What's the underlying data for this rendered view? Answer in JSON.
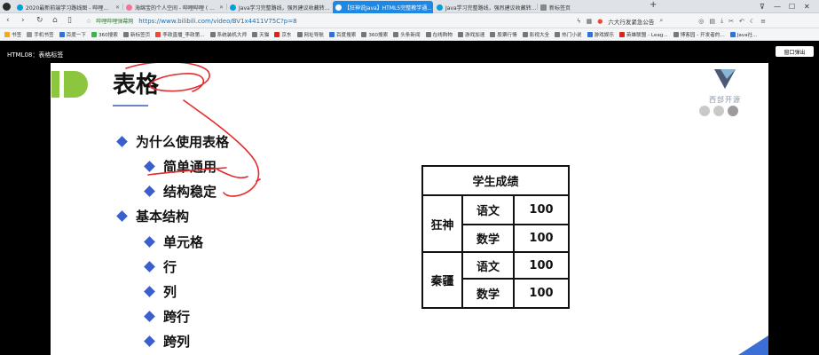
{
  "browser": {
    "tabs": [
      {
        "label": "2020最新前端学习路线图 - 哔哩...",
        "color": "#00a1d6",
        "active": false
      },
      {
        "label": "海绵宝的个人空间 - 哔哩哔哩 ( ...",
        "color": "#fb7299",
        "active": false
      },
      {
        "label": "Java学习完整路线，强烈建议收藏转...",
        "color": "#00a1d6",
        "active": false
      },
      {
        "label": "【狂神说Java】HTML5完整教学通...",
        "color": "#00a1d6",
        "active": true
      },
      {
        "label": "Java学习完整路线，强烈建议收藏转...",
        "color": "#00a1d6",
        "active": false
      },
      {
        "label": "新标签页",
        "color": "#888888",
        "active": false
      }
    ],
    "new_tab": "+",
    "window_controls": [
      "⊽",
      "—",
      "☐",
      "✕"
    ],
    "url_badge": "哔哩哔哩弹幕网",
    "url": "https://www.bilibili.com/video/BV1x4411V75C?p=8",
    "search_hint": "六大行发紧急公告",
    "bookmarks": [
      {
        "label": "书签",
        "color": "#f5a623"
      },
      {
        "label": "手机书签",
        "color": "#999999"
      },
      {
        "label": "百度一下",
        "color": "#2f6fde"
      },
      {
        "label": "360搜索",
        "color": "#3bb54a"
      },
      {
        "label": "新标签页",
        "color": "#777777"
      },
      {
        "label": "李政直播_李政第...",
        "color": "#e84b3c"
      },
      {
        "label": "系统装机大师",
        "color": "#777777"
      },
      {
        "label": "天猫",
        "color": "#777777"
      },
      {
        "label": "京东",
        "color": "#d7261b"
      },
      {
        "label": "网址导航",
        "color": "#777777"
      },
      {
        "label": "百度搜索",
        "color": "#2f6fde"
      },
      {
        "label": "360搜索",
        "color": "#777777"
      },
      {
        "label": "头条新闻",
        "color": "#777777"
      },
      {
        "label": "在线购物",
        "color": "#777777"
      },
      {
        "label": "游戏加速",
        "color": "#777777"
      },
      {
        "label": "股票行情",
        "color": "#777777"
      },
      {
        "label": "影视大全",
        "color": "#777777"
      },
      {
        "label": "热门小说",
        "color": "#777777"
      },
      {
        "label": "游戏娱乐",
        "color": "#2f6fde"
      },
      {
        "label": "英雄联盟 - Leag...",
        "color": "#d7261b"
      },
      {
        "label": "博客园 - 开发者的...",
        "color": "#777777"
      },
      {
        "label": "Java社...",
        "color": "#2f6fde"
      }
    ]
  },
  "video": {
    "title": "HTML08：表格标签",
    "popout_label": "窗口弹出"
  },
  "slide": {
    "title": "表格",
    "brand_name": "西部开源",
    "bullets": [
      {
        "text": "为什么使用表格",
        "level": 1
      },
      {
        "text": "简单通用",
        "level": 2
      },
      {
        "text": "结构稳定",
        "level": 2
      },
      {
        "text": "基本结构",
        "level": 1
      },
      {
        "text": "单元格",
        "level": 2
      },
      {
        "text": "行",
        "level": 2
      },
      {
        "text": "列",
        "level": 2
      },
      {
        "text": "跨行",
        "level": 2
      },
      {
        "text": "跨列",
        "level": 2
      }
    ],
    "table": {
      "caption": "学生成绩",
      "groups": [
        {
          "name": "狂神",
          "rows": [
            {
              "subject": "语文",
              "score": "100"
            },
            {
              "subject": "数学",
              "score": "100"
            }
          ]
        },
        {
          "name": "秦疆",
          "rows": [
            {
              "subject": "语文",
              "score": "100"
            },
            {
              "subject": "数学",
              "score": "100"
            }
          ]
        }
      ]
    }
  },
  "colors": {
    "accent": "#1e88e5",
    "bullet": "#3a5fcd",
    "annotation": "#e52b2b",
    "logo_green": "#8cc63f"
  }
}
